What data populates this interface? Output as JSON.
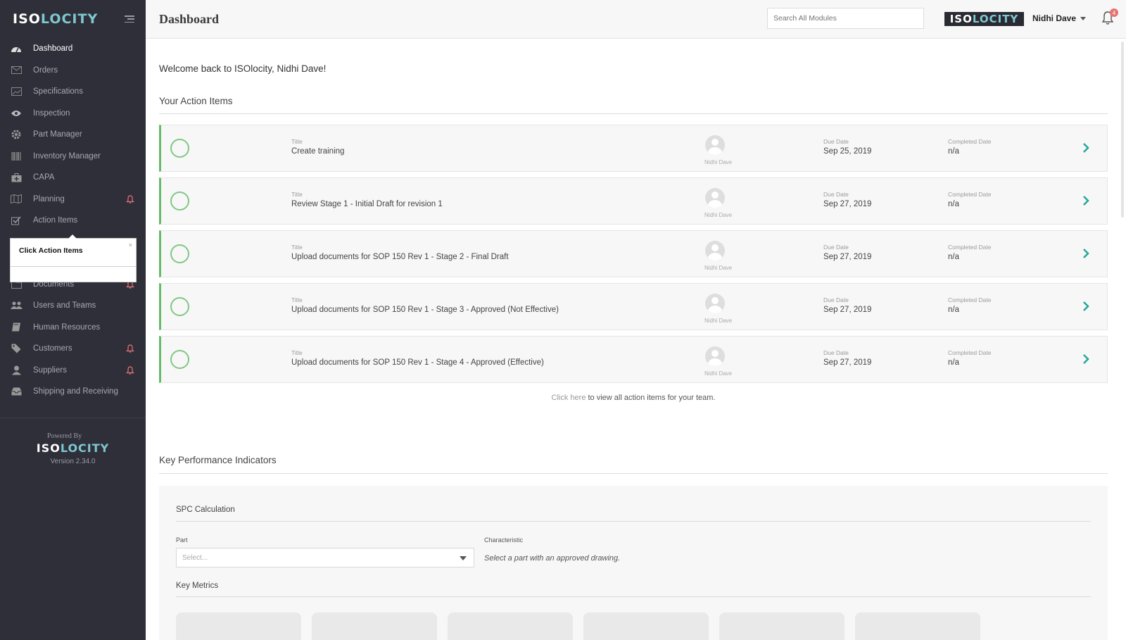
{
  "sidebar": {
    "logo_iso": "ISO",
    "logo_locity": "LOCITY",
    "items": [
      {
        "label": "Dashboard",
        "icon": "dashboard-icon",
        "active": true,
        "bell": false
      },
      {
        "label": "Orders",
        "icon": "envelope-icon",
        "active": false,
        "bell": false
      },
      {
        "label": "Specifications",
        "icon": "image-icon",
        "active": false,
        "bell": false
      },
      {
        "label": "Inspection",
        "icon": "eye-icon",
        "active": false,
        "bell": false
      },
      {
        "label": "Part Manager",
        "icon": "gear-icon",
        "active": false,
        "bell": false
      },
      {
        "label": "Inventory Manager",
        "icon": "barcode-icon",
        "active": false,
        "bell": false
      },
      {
        "label": "CAPA",
        "icon": "medkit-icon",
        "active": false,
        "bell": false
      },
      {
        "label": "Planning",
        "icon": "map-icon",
        "active": false,
        "bell": true
      },
      {
        "label": "Action Items",
        "icon": "checkbox-icon",
        "active": false,
        "bell": false
      },
      {
        "label": "Documents",
        "icon": "folder-icon",
        "active": false,
        "bell": true
      },
      {
        "label": "Users and Teams",
        "icon": "users-icon",
        "active": false,
        "bell": false
      },
      {
        "label": "Human Resources",
        "icon": "book-icon",
        "active": false,
        "bell": false
      },
      {
        "label": "Customers",
        "icon": "tag-icon",
        "active": false,
        "bell": true
      },
      {
        "label": "Suppliers",
        "icon": "supplier-icon",
        "active": false,
        "bell": true
      },
      {
        "label": "Shipping and Receiving",
        "icon": "inbox-icon",
        "active": false,
        "bell": false
      }
    ],
    "footer": {
      "powered_by": "Powered By",
      "logo_iso": "ISO",
      "logo_locity": "LOCITY",
      "version": "Version 2.34.0"
    }
  },
  "tooltip": {
    "text": "Click Action Items",
    "close": "×"
  },
  "header": {
    "title": "Dashboard",
    "search_placeholder": "Search All Modules",
    "brand_iso": "ISO",
    "brand_locity": "LOCITY",
    "user_name": "Nidhi Dave",
    "notification_count": "4"
  },
  "main": {
    "welcome": "Welcome back to ISOlocity, Nidhi Dave!",
    "action_items_title": "Your Action Items",
    "labels": {
      "title": "Title",
      "due_date": "Due Date",
      "completed_date": "Completed Date"
    },
    "action_items": [
      {
        "title": "Create training",
        "assignee": "Nidhi Dave",
        "due": "Sep 25, 2019",
        "completed": "n/a"
      },
      {
        "title": "Review Stage 1 - Initial Draft for revision 1",
        "assignee": "Nidhi Dave",
        "due": "Sep 27, 2019",
        "completed": "n/a"
      },
      {
        "title": "Upload documents for SOP 150 Rev 1 - Stage 2 - Final Draft",
        "assignee": "Nidhi Dave",
        "due": "Sep 27, 2019",
        "completed": "n/a"
      },
      {
        "title": "Upload documents for SOP 150 Rev 1 - Stage 3 - Approved (Not Effective)",
        "assignee": "Nidhi Dave",
        "due": "Sep 27, 2019",
        "completed": "n/a"
      },
      {
        "title": "Upload documents for SOP 150 Rev 1 - Stage 4 - Approved (Effective)",
        "assignee": "Nidhi Dave",
        "due": "Sep 27, 2019",
        "completed": "n/a"
      }
    ],
    "team_link": "Click here",
    "team_text": " to view all action items for your team.",
    "kpi_title": "Key Performance Indicators",
    "spc_title": "SPC Calculation",
    "part_label": "Part",
    "part_placeholder": "Select...",
    "characteristic_label": "Characteristic",
    "characteristic_hint": "Select a part with an approved drawing.",
    "key_metrics_title": "Key Metrics",
    "metric_card_count": 6
  },
  "colors": {
    "sidebar_bg": "#2f2f3a",
    "accent_teal": "#7ec8cf",
    "action_green": "#66bb6a",
    "alert_red": "#e57373",
    "chevron": "#26a69a"
  }
}
